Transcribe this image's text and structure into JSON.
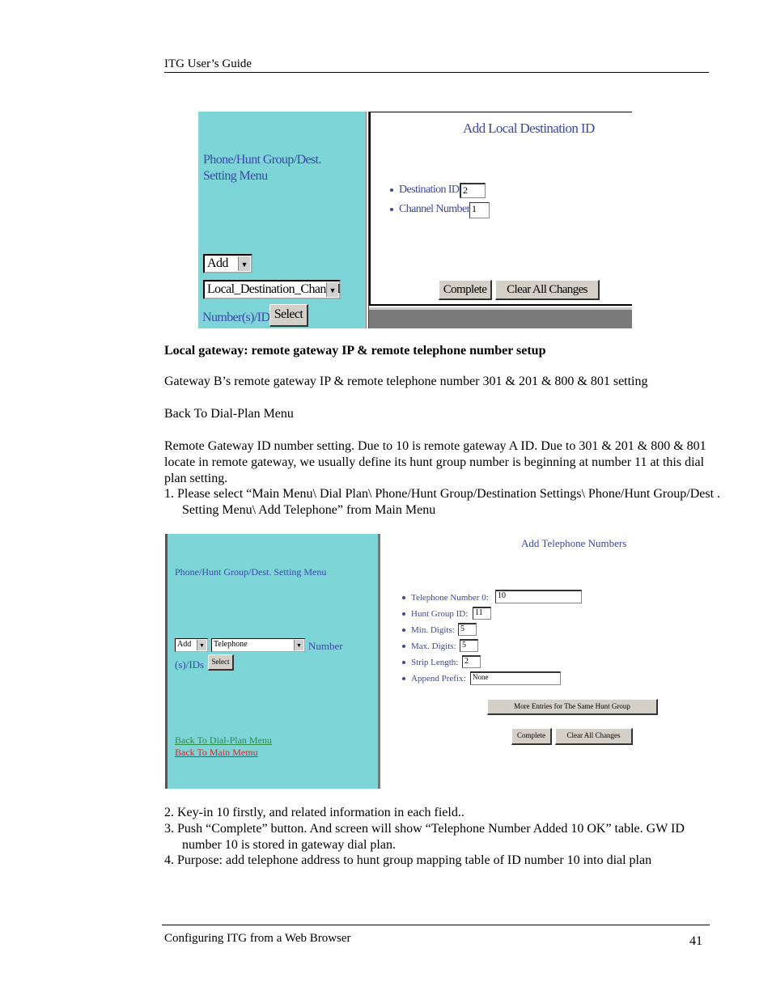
{
  "header": {
    "title": "ITG User’s Guide"
  },
  "screenshot1": {
    "menu_title": "Phone/Hunt Group/Dest. Setting Menu",
    "action_select": "Add",
    "type_select": "Local_Destination_Channel",
    "numbers_label": "Number(s)/IDs",
    "select_button": "Select",
    "form_title": "Add Local Destination ID",
    "fields": [
      {
        "label": "Destination ID:",
        "value": "2"
      },
      {
        "label": "Channel Number:",
        "value": "1"
      }
    ],
    "complete_button": "Complete",
    "clear_button": "Clear All Changes"
  },
  "text": {
    "heading": "Local gateway: remote gateway IP & remote telephone number setup",
    "p1": "Gateway B’s remote gateway IP & remote telephone number 301 & 201 & 800 & 801 setting",
    "p2": "Back To Dial-Plan Menu",
    "p3": "Remote Gateway ID number setting. Due to 10 is remote gateway A ID. Due to 301 & 201 & 800 & 801 locate in remote gateway, we usually define its hunt group number is beginning at number 11 at this dial plan setting.",
    "step1": "1. Please select “Main Menu\\ Dial Plan\\ Phone/Hunt Group/Destination Settings\\ Phone/Hunt Group/Dest . Setting Menu\\ Add Telephone” from Main Menu",
    "step2": "2. Key-in 10 firstly, and related information in each field..",
    "step3": "3. Push “Complete” button. And screen will show “Telephone Number Added 10 OK” table. GW ID number 10 is stored in gateway dial plan.",
    "step4": "4. Purpose: add telephone address to hunt group mapping table of ID number 10 into dial plan"
  },
  "screenshot2": {
    "menu_title": "Phone/Hunt Group/Dest. Setting Menu",
    "action_select": "Add",
    "type_select": "Telephone",
    "numbers_label_a": "Number",
    "numbers_label_b": "(s)/IDs",
    "select_button": "Select",
    "link_dialplan": "Back To Dial-Plan Menu",
    "link_main": "Back To Main Memu",
    "form_title": "Add Telephone Numbers",
    "fields": [
      {
        "label": "Telephone Number 0:",
        "value": "10"
      },
      {
        "label": "Hunt Group ID:",
        "value": "11"
      },
      {
        "label": "Min. Digits:",
        "value": "5"
      },
      {
        "label": "Max. Digits:",
        "value": "5"
      },
      {
        "label": "Strip Length:",
        "value": "2"
      },
      {
        "label": "Append Prefix:",
        "value": "None"
      }
    ],
    "more_button": "More Entries for The Same Hunt Group",
    "complete_button": "Complete",
    "clear_button": "Clear All Changes"
  },
  "footer": {
    "title": "Configuring ITG from a Web Browser",
    "page": "41"
  }
}
